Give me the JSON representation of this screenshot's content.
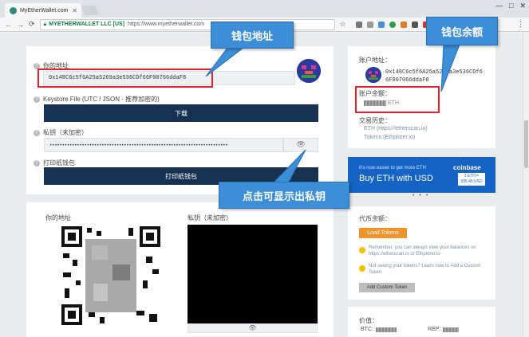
{
  "browser": {
    "tab_title": "MyEtherWallet.com",
    "site_identity": "MYETHERWALLET LLC [US]",
    "url": "https://www.myetherwallet.com",
    "window_controls": [
      "—",
      "□",
      "✕"
    ]
  },
  "wallet": {
    "your_address_label": "你的地址",
    "address_value": "0x148C6c5f6A25a5269a3e536CDf66F00766ddaF8",
    "keystore_label": "Keystore File (UTC / JSON · 推荐加密的)",
    "download_label": "下载",
    "private_key_label": "私钥（未加密）",
    "private_key_value": "••••••••••••••••••••••••••••••••••••••••••••••••••••••••••••••••••••••••",
    "paper_wallet_label": "打印纸钱包",
    "print_button_label": "打印纸钱包"
  },
  "qr_section": {
    "address_label": "你的地址",
    "private_key_label": "私钥（未加密）"
  },
  "account": {
    "address_label": "账户地址：",
    "address_line1": "0x148C6c5f6A25a5269a3e536CDf6",
    "address_line2": "6F007066ddaF8",
    "balance_label": "账户余额：",
    "balance_unit": "ETH",
    "history_label": "交易历史：",
    "history_links": [
      "ETH (https://etherscan.io)",
      "Tokens (Ethplorer.io)"
    ]
  },
  "banner": {
    "small_text": "It's now easier to get more ETH",
    "big_text": "Buy ETH with USD",
    "brand": "coinbase",
    "rate_line1": "1 ETH =",
    "rate_line2": "335.45 USD",
    "dots": "• • •"
  },
  "tokens": {
    "label": "代币余额：",
    "load_button": "Load Tokens",
    "remember_text": "Remember, you can always view your balances on https://etherscan.io or Ethplorer.io",
    "not_seeing_text": "Not seeing your tokens? Learn how to Add a Custom Token",
    "add_custom_button": "Add Custom Token"
  },
  "price": {
    "label": "价值：",
    "btc_label": "BTC:",
    "rep_label": "REP:"
  },
  "annotations": {
    "wallet_address": "钱包地址",
    "wallet_balance": "钱包余额",
    "show_private_key": "点击可显示出私钥"
  },
  "colors": {
    "accent_dark": "#163151",
    "callout_blue": "#3c8fd6",
    "highlight_red": "#e0222a",
    "token_orange": "#f0932b",
    "coinbase_blue": "#1563c4"
  }
}
